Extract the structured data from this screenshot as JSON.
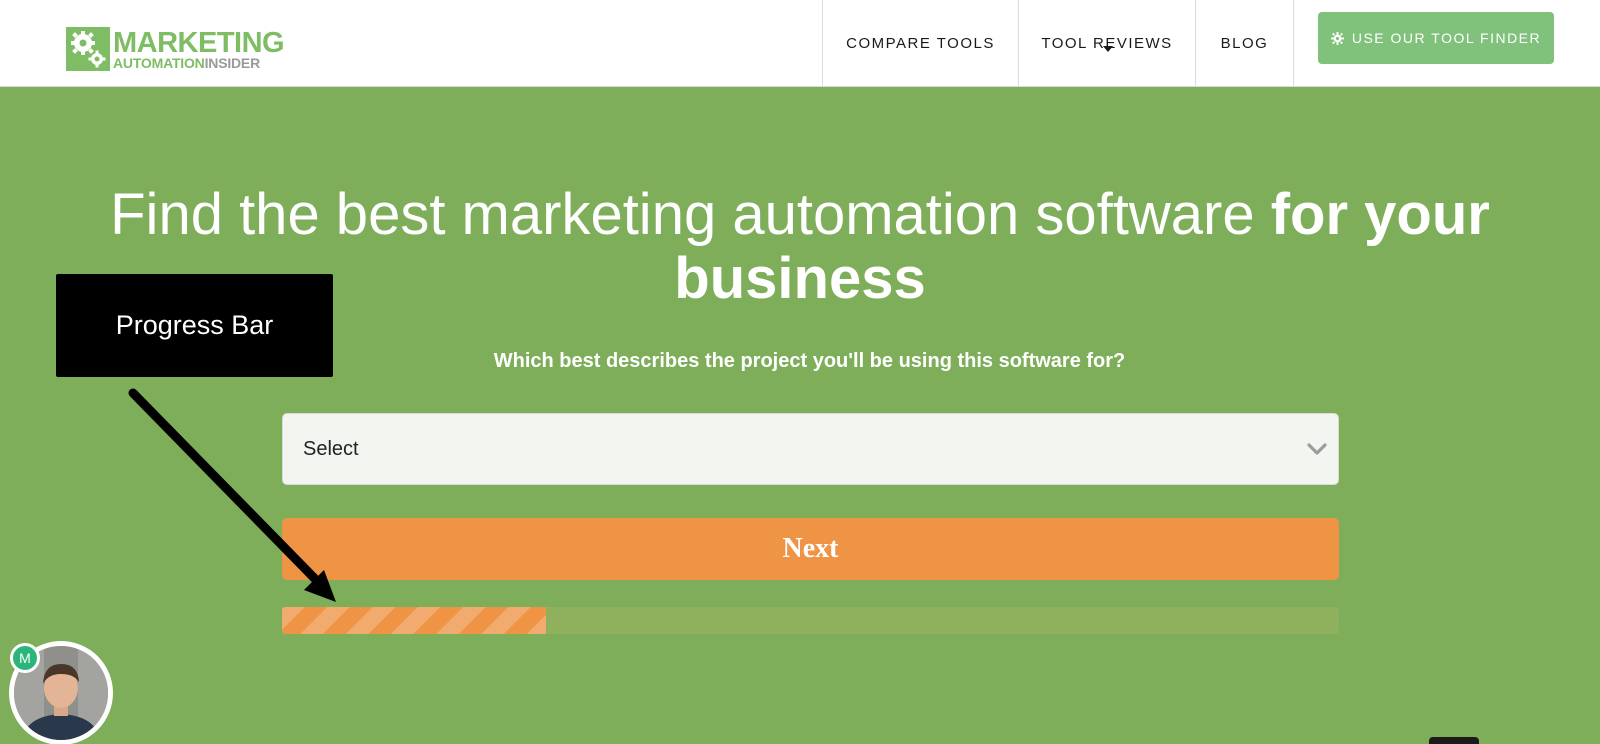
{
  "header": {
    "logo": {
      "line1": "MARKETING",
      "line2a": "AUTOMATION",
      "line2b": "INSIDER",
      "icon": "gears-icon"
    },
    "nav": [
      {
        "label": "COMPARE TOOLS"
      },
      {
        "label": "TOOL REVIEWS",
        "has_dropdown": true
      },
      {
        "label": "BLOG"
      }
    ],
    "cta": {
      "label": "USE OUR TOOL FINDER",
      "icon": "gear-icon"
    }
  },
  "hero": {
    "title_regular": "Find the best marketing automation software ",
    "title_bold": "for your business",
    "question": "Which best describes the project you'll be using this software for?"
  },
  "form": {
    "select": {
      "value": "Select",
      "icon": "chevron-down-icon"
    },
    "next_label": "Next",
    "progress_fraction": 0.25
  },
  "annotation": {
    "label": "Progress Bar",
    "arrow_icon": "arrow-icon"
  },
  "chat": {
    "badge": "M"
  },
  "colors": {
    "brand_green": "#7ebd64",
    "hero_bg": "#7eae5a",
    "cta_green": "#80c27b",
    "accent_orange": "#ef9345",
    "progress_track": "#8fb05c"
  }
}
